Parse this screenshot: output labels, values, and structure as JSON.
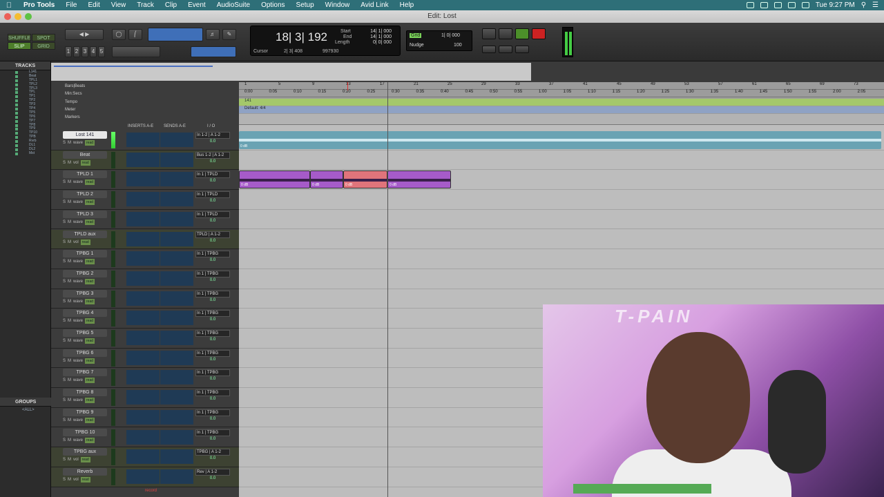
{
  "menubar": {
    "app": "Pro Tools",
    "items": [
      "File",
      "Edit",
      "View",
      "Track",
      "Clip",
      "Event",
      "AudioSuite",
      "Options",
      "Setup",
      "Window",
      "Avid Link",
      "Help"
    ],
    "clock": "Tue 9:27 PM"
  },
  "window": {
    "title": "Edit: Lost"
  },
  "toolbar": {
    "modes": [
      "SHUFFLE",
      "SPOT",
      "SLIP",
      "GRID"
    ],
    "zoom_presets": [
      "1",
      "2",
      "3",
      "4",
      "5"
    ],
    "counter": {
      "main": "18| 3| 192",
      "cursor_label": "Cursor",
      "cursor_value": "2| 3| 408",
      "sample": "997930",
      "start_label": "Start",
      "end_label": "End",
      "length_label": "Length",
      "start": "14| 1| 000",
      "end": "14| 1| 000",
      "length": "0| 0| 000"
    },
    "grid_label": "Grid",
    "grid_value": "1| 0| 000",
    "nudge_label": "Nudge",
    "nudge_value": "100"
  },
  "tracks_panel": {
    "title": "TRACKS",
    "items": [
      "L141",
      "Beat",
      "TPL1",
      "TPL2",
      "TPL3",
      "TPL",
      "TP1",
      "TP2",
      "TP3",
      "TP4",
      "TP5",
      "TP6",
      "TP7",
      "TP8",
      "TP9",
      "TP10",
      "TPB",
      "Rvrb",
      "DL1",
      "DL2",
      "Mst"
    ]
  },
  "groups_panel": {
    "title": "GROUPS",
    "item": "<ALL>"
  },
  "rulers": {
    "labels": [
      "Bars|Beats",
      "Min:Secs",
      "Tempo",
      "Meter",
      "Markers"
    ],
    "bars": [
      "1",
      "5",
      "9",
      "13",
      "17",
      "21",
      "25",
      "29",
      "33",
      "37",
      "41",
      "45",
      "49",
      "53",
      "57",
      "61",
      "65",
      "69",
      "73"
    ],
    "secs": [
      "0:00",
      "0:05",
      "0:10",
      "0:15",
      "0:20",
      "0:25",
      "0:30",
      "0:35",
      "0:40",
      "0:45",
      "0:50",
      "0:55",
      "1:00",
      "1:05",
      "1:10",
      "1:15",
      "1:20",
      "1:25",
      "1:30",
      "1:35",
      "1:40",
      "1:45",
      "1:50",
      "1:55",
      "2:00",
      "2:05"
    ],
    "tempo": "141",
    "meter": "Default: 4/4"
  },
  "column_headers": {
    "inserts": "INSERTS A-E",
    "sends": "SENDS A-E",
    "io": "I / O"
  },
  "tracks": [
    {
      "name": "Lost 141",
      "in": "In 1-2",
      "out": "A 1-2",
      "vol": "0.0",
      "kind": "wave"
    },
    {
      "name": "Beat",
      "in": "Bus 1-2",
      "out": "A 1-2",
      "vol": "0.0",
      "kind": "vol"
    },
    {
      "name": "TPLD 1",
      "in": "In 1",
      "out": "TPLD",
      "vol": "0.0",
      "kind": "wave"
    },
    {
      "name": "TPLD 2",
      "in": "In 1",
      "out": "TPLD",
      "vol": "0.0",
      "kind": "wave"
    },
    {
      "name": "TPLD 3",
      "in": "In 1",
      "out": "TPLD",
      "vol": "0.0",
      "kind": "wave"
    },
    {
      "name": "TPLD aux",
      "in": "TPLD",
      "out": "A 1-2",
      "vol": "0.0",
      "kind": "vol"
    },
    {
      "name": "TPBG 1",
      "in": "In 1",
      "out": "TPBG",
      "vol": "0.0",
      "kind": "wave"
    },
    {
      "name": "TPBG 2",
      "in": "In 1",
      "out": "TPBG",
      "vol": "0.0",
      "kind": "wave"
    },
    {
      "name": "TPBG 3",
      "in": "In 1",
      "out": "TPBG",
      "vol": "0.0",
      "kind": "wave"
    },
    {
      "name": "TPBG 4",
      "in": "In 1",
      "out": "TPBG",
      "vol": "0.0",
      "kind": "wave"
    },
    {
      "name": "TPBG 5",
      "in": "In 1",
      "out": "TPBG",
      "vol": "0.0",
      "kind": "wave"
    },
    {
      "name": "TPBG 6",
      "in": "In 1",
      "out": "TPBG",
      "vol": "0.0",
      "kind": "wave"
    },
    {
      "name": "TPBG 7",
      "in": "In 1",
      "out": "TPBG",
      "vol": "0.0",
      "kind": "wave"
    },
    {
      "name": "TPBG 8",
      "in": "In 1",
      "out": "TPBG",
      "vol": "0.0",
      "kind": "wave"
    },
    {
      "name": "TPBG 9",
      "in": "In 1",
      "out": "TPBG",
      "vol": "0.0",
      "kind": "wave"
    },
    {
      "name": "TPBG 10",
      "in": "In 1",
      "out": "TPBG",
      "vol": "0.0",
      "kind": "wave"
    },
    {
      "name": "TPBG aux",
      "in": "TPBG",
      "out": "A 1-2",
      "vol": "0.0",
      "kind": "vol"
    },
    {
      "name": "Reverb",
      "in": "Rev",
      "out": "A 1-2",
      "vol": "0.0",
      "kind": "vol"
    }
  ],
  "clips": {
    "gain_a": "0 dB",
    "gain_b": "0 dB",
    "gain_c": "0 dB",
    "gain_d": "0 dB",
    "gain_e": "0 dB"
  },
  "status": {
    "record": "record"
  },
  "webcam": {
    "brand": "T-PAIN"
  }
}
